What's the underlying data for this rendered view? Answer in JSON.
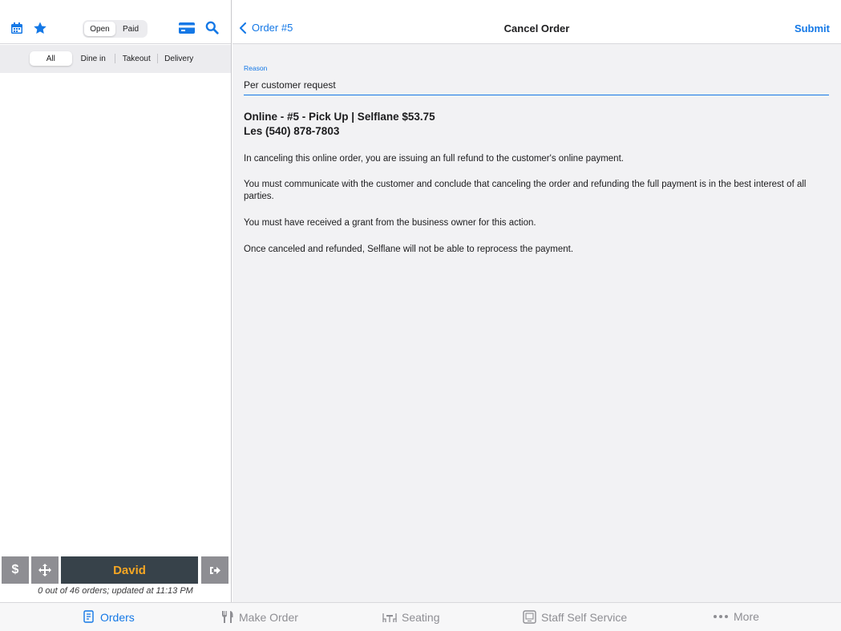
{
  "left": {
    "status_segment": [
      "Open",
      "Paid"
    ],
    "status_selected": "Open",
    "filters": [
      "All",
      "Dine in",
      "Takeout",
      "Delivery"
    ],
    "filter_selected": "All",
    "user_name": "David",
    "status_text": "0 out of 46 orders; updated at 11:13 PM"
  },
  "nav": {
    "back_label": "Order #5",
    "title": "Cancel Order",
    "submit_label": "Submit"
  },
  "form": {
    "reason_label": "Reason",
    "reason_value": "Per customer request"
  },
  "summary": {
    "line1": "Online - #5 - Pick Up | Selflane $53.75",
    "line2": "Les (540) 878-7803"
  },
  "paragraphs": [
    "In canceling this online order, you are issuing an full refund to the customer's online payment.",
    "You must communicate with the customer and conclude that canceling the order and refunding the full payment is in the best interest of all parties.",
    "You must have received a grant from the business owner for this action.",
    "Once canceled and refunded, Selflane will not be able to reprocess the payment."
  ],
  "tabs": [
    {
      "label": "Orders",
      "icon": "receipt-icon"
    },
    {
      "label": "Make Order",
      "icon": "utensils-icon"
    },
    {
      "label": "Seating",
      "icon": "seating-icon"
    },
    {
      "label": "Staff Self Service",
      "icon": "kiosk-icon"
    },
    {
      "label": "More",
      "icon": "more-dots-icon"
    }
  ],
  "colors": {
    "accent": "#1478e6",
    "user_bar": "#37424a",
    "user_name": "#f5a623",
    "tool_gray": "#8e8e93"
  }
}
